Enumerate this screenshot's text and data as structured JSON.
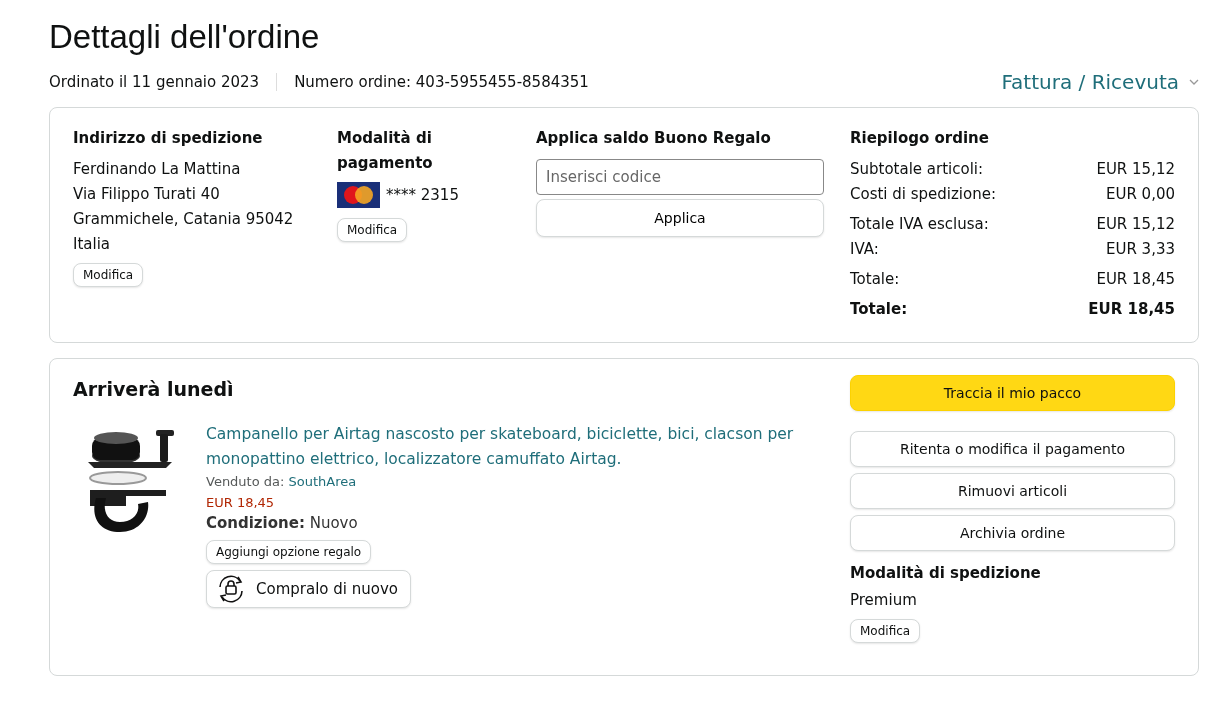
{
  "page_title": "Dettagli dell'ordine",
  "order_date": "Ordinato il 11 gennaio 2023",
  "order_number": "Numero ordine: 403-5955455-8584351",
  "invoice_link": "Fattura / Ricevuta",
  "shipping_address": {
    "heading": "Indirizzo di spedizione",
    "lines": [
      "Ferdinando La Mattina",
      "Via Filippo Turati 40",
      "Grammichele, Catania 95042",
      "Italia"
    ],
    "button": "Modifica"
  },
  "payment": {
    "heading": "Modalità di pagamento",
    "card_digits": "**** 2315",
    "button": "Modifica"
  },
  "gift_card": {
    "heading": "Applica saldo Buono Regalo",
    "placeholder": "Inserisci codice",
    "button": "Applica"
  },
  "summary": {
    "heading": "Riepilogo ordine",
    "groups": [
      [
        {
          "label": "Subtotale articoli:",
          "value": "EUR 15,12",
          "kind": "line"
        },
        {
          "label": "Costi di spedizione:",
          "value": "EUR 0,00",
          "kind": "line"
        }
      ],
      [
        {
          "label": "Totale IVA esclusa:",
          "value": "EUR 15,12",
          "kind": "line"
        },
        {
          "label": "IVA:",
          "value": "EUR 3,33",
          "kind": "line"
        }
      ],
      [
        {
          "label": "Totale:",
          "value": "EUR 18,45",
          "kind": "line"
        }
      ],
      [
        {
          "label": "Totale:",
          "value": "EUR 18,45",
          "kind": "total"
        }
      ]
    ]
  },
  "shipment": {
    "heading": "Arriverà lunedì",
    "product": {
      "title": "Campanello per Airtag nascosto per skateboard, biciclette, bici, clacson per monopattino elettrico, localizzatore camuffato Airtag.",
      "sold_by_label": "Venduto da:",
      "seller": "SouthArea",
      "price": "EUR 18,45",
      "condition_label": "Condizione:",
      "condition": "Nuovo",
      "gift_button": "Aggiungi opzione regalo",
      "buy_again_button": "Compralo di nuovo"
    },
    "actions": [
      {
        "label": "Traccia il mio pacco",
        "kind": "primary"
      },
      {
        "label": "Ritenta o modifica il pagamento",
        "kind": "secondary"
      },
      {
        "label": "Rimuovi articoli",
        "kind": "secondary"
      },
      {
        "label": "Archivia ordine",
        "kind": "secondary"
      }
    ],
    "shipping_method": {
      "heading": "Modalità di spedizione",
      "value": "Premium",
      "button": "Modifica"
    }
  }
}
